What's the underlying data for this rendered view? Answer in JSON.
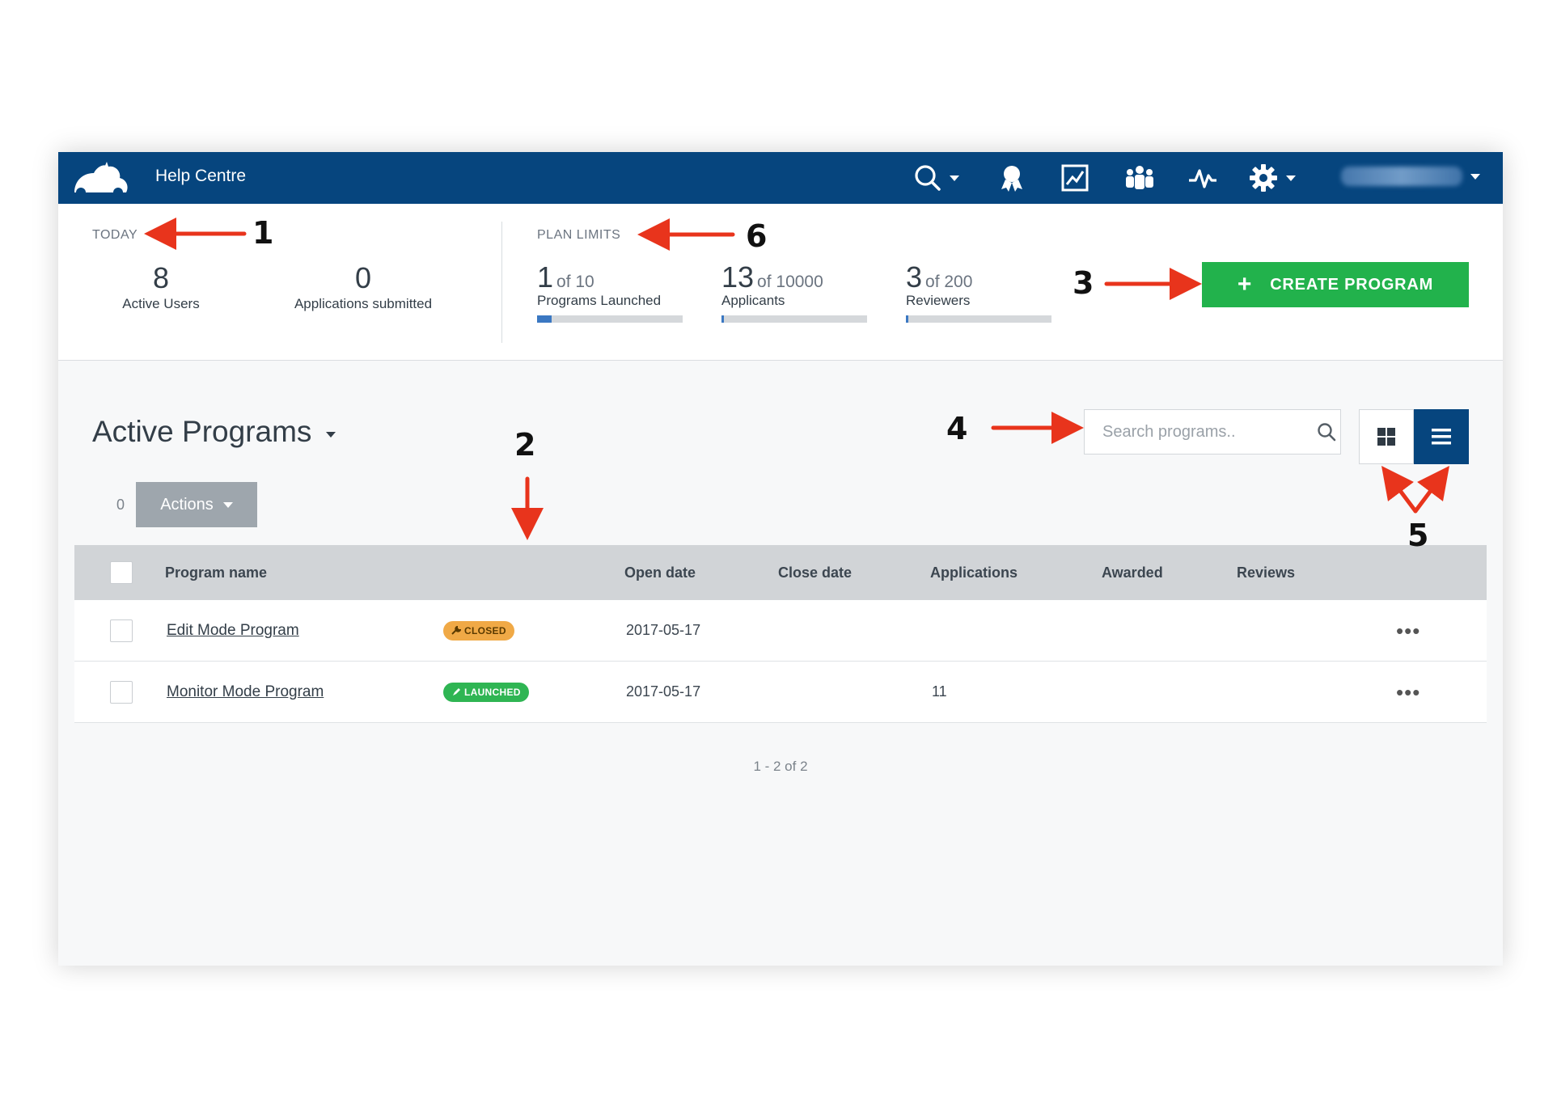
{
  "nav": {
    "title": "Help Centre",
    "icons": [
      "search-icon",
      "award-icon",
      "analytics-icon",
      "team-icon",
      "activity-icon",
      "gear-icon"
    ]
  },
  "today": {
    "label": "TODAY",
    "active_users": {
      "value": "8",
      "label": "Active Users"
    },
    "applications_submitted": {
      "value": "0",
      "label": "Applications submitted"
    }
  },
  "plan_limits": {
    "label": "PLAN LIMITS",
    "items": [
      {
        "value": "1",
        "of": "of 10",
        "label": "Programs Launched",
        "fraction": 0.1
      },
      {
        "value": "13",
        "of": "of 10000",
        "label": "Applicants",
        "fraction": 0.0013
      },
      {
        "value": "3",
        "of": "of 200",
        "label": "Reviewers",
        "fraction": 0.015
      }
    ]
  },
  "create_program": {
    "label": "CREATE PROGRAM"
  },
  "annotations": [
    "1",
    "2",
    "3",
    "4",
    "5",
    "6"
  ],
  "programs": {
    "title": "Active Programs",
    "search_placeholder": "Search programs..",
    "selected_count": "0",
    "actions_label": "Actions",
    "columns": [
      "Program name",
      "Open date",
      "Close date",
      "Applications",
      "Awarded",
      "Reviews"
    ],
    "rows": [
      {
        "name": "Edit Mode Program",
        "status": "CLOSED",
        "open_date": "2017-05-17",
        "close_date": "",
        "applications": "",
        "awarded": "",
        "reviews": ""
      },
      {
        "name": "Monitor Mode Program",
        "status": "LAUNCHED",
        "open_date": "2017-05-17",
        "close_date": "",
        "applications": "11",
        "awarded": "",
        "reviews": ""
      }
    ],
    "pagination": "1 - 2 of 2"
  },
  "colors": {
    "nav_bg": "#06457e",
    "create_btn": "#22b24c",
    "badge_closed": "#f0a946",
    "badge_launched": "#2fb553",
    "annotation_arrow": "#e8341c"
  }
}
